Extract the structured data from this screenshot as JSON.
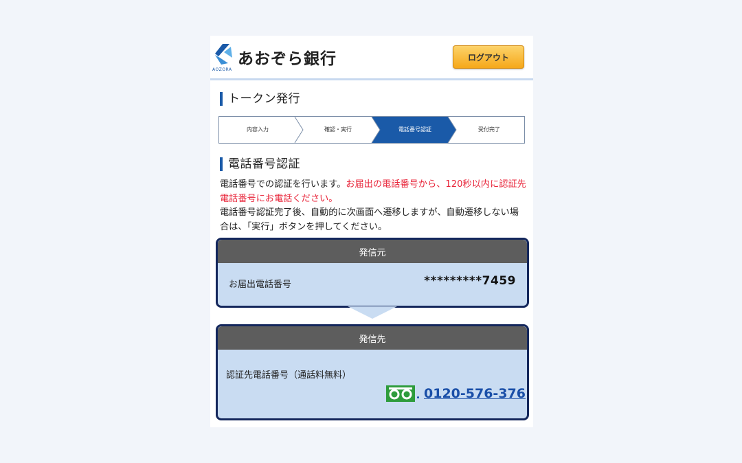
{
  "header": {
    "logo_text": "あおぞら銀行",
    "logo_sub": "AOZORA",
    "logout_label": "ログアウト"
  },
  "page_title": "トークン発行",
  "steps": [
    {
      "label": "内容入力",
      "active": false
    },
    {
      "label": "確認・実行",
      "active": false
    },
    {
      "label": "電話番号認証",
      "active": true
    },
    {
      "label": "受付完了",
      "active": false
    }
  ],
  "section_title": "電話番号認証",
  "description": {
    "part1": "電話番号での認証を行います。",
    "part2_red": "お届出の電話番号から、120秒以内に認証先電話番号にお電話ください。",
    "part3": "電話番号認証完了後、自動的に次画面へ遷移しますが、自動遷移しない場合は、「実行」ボタンを押してください。"
  },
  "caller_box": {
    "header": "発信元",
    "label": "お届出電話番号",
    "value": "*********7459"
  },
  "callee_box": {
    "header": "発信先",
    "label": "認証先電話番号（通話料無料）",
    "number": "0120-576-376",
    "freedial_icon": "freedial-icon"
  },
  "colors": {
    "brand_blue": "#1a5aa8",
    "logout_orange": "#f6a81a",
    "active_step": "#1a5aa8",
    "alert_red": "#e8253a",
    "box_border": "#14275c",
    "box_bg": "#c9dcf2",
    "box_header": "#5d5d5d",
    "freedial_green": "#2e9c3c"
  }
}
